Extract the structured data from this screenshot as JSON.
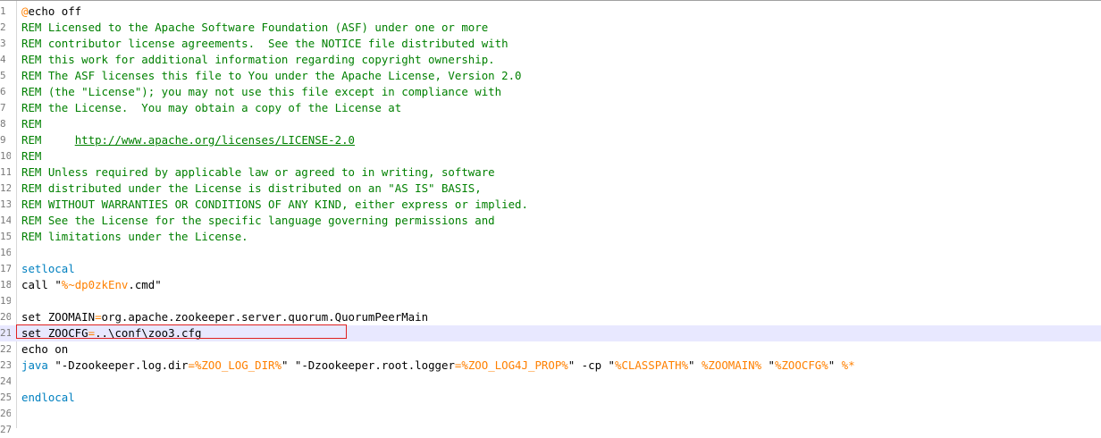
{
  "editor": {
    "highlight_color": "#e02020",
    "current_line": 21,
    "lines": [
      {
        "n": "1",
        "tokens": [
          {
            "t": "@",
            "c": "t-echo"
          },
          {
            "t": "echo off",
            "c": "t-plain"
          }
        ]
      },
      {
        "n": "2",
        "tokens": [
          {
            "t": "REM Licensed to the Apache Software Foundation (ASF) under one or more",
            "c": "t-comment"
          }
        ]
      },
      {
        "n": "3",
        "tokens": [
          {
            "t": "REM contributor license agreements.  See the NOTICE file distributed with",
            "c": "t-comment"
          }
        ]
      },
      {
        "n": "4",
        "tokens": [
          {
            "t": "REM this work for additional information regarding copyright ownership.",
            "c": "t-comment"
          }
        ]
      },
      {
        "n": "5",
        "tokens": [
          {
            "t": "REM The ASF licenses this file to You under the Apache License, Version 2.0",
            "c": "t-comment"
          }
        ]
      },
      {
        "n": "6",
        "tokens": [
          {
            "t": "REM (the \"License\"); you may not use this file except in compliance with",
            "c": "t-comment"
          }
        ]
      },
      {
        "n": "7",
        "tokens": [
          {
            "t": "REM the License.  You may obtain a copy of the License at",
            "c": "t-comment"
          }
        ]
      },
      {
        "n": "8",
        "tokens": [
          {
            "t": "REM",
            "c": "t-comment"
          }
        ]
      },
      {
        "n": "9",
        "tokens": [
          {
            "t": "REM     ",
            "c": "t-comment"
          },
          {
            "t": "http://www.apache.org/licenses/LICENSE-2.0",
            "c": "t-link"
          }
        ]
      },
      {
        "n": "10",
        "tokens": [
          {
            "t": "REM",
            "c": "t-comment"
          }
        ]
      },
      {
        "n": "11",
        "tokens": [
          {
            "t": "REM Unless required by applicable law or agreed to in writing, software",
            "c": "t-comment"
          }
        ]
      },
      {
        "n": "12",
        "tokens": [
          {
            "t": "REM distributed under the License is distributed on an \"AS IS\" BASIS,",
            "c": "t-comment"
          }
        ]
      },
      {
        "n": "13",
        "tokens": [
          {
            "t": "REM WITHOUT WARRANTIES OR CONDITIONS OF ANY KIND, either express or implied.",
            "c": "t-comment"
          }
        ]
      },
      {
        "n": "14",
        "tokens": [
          {
            "t": "REM See the License for the specific language governing permissions and",
            "c": "t-comment"
          }
        ]
      },
      {
        "n": "15",
        "tokens": [
          {
            "t": "REM limitations under the License.",
            "c": "t-comment"
          }
        ]
      },
      {
        "n": "16",
        "tokens": []
      },
      {
        "n": "17",
        "tokens": [
          {
            "t": "setlocal",
            "c": "t-blue"
          }
        ]
      },
      {
        "n": "18",
        "tokens": [
          {
            "t": "call ",
            "c": "t-plain"
          },
          {
            "t": "\"",
            "c": "t-plain"
          },
          {
            "t": "%~dp0zkEnv",
            "c": "t-var"
          },
          {
            "t": ".cmd\"",
            "c": "t-plain"
          }
        ]
      },
      {
        "n": "19",
        "tokens": []
      },
      {
        "n": "20",
        "tokens": [
          {
            "t": "set ZOOMAIN",
            "c": "t-plain"
          },
          {
            "t": "=",
            "c": "t-var"
          },
          {
            "t": "org.apache.zookeeper.server.quorum.QuorumPeerMain",
            "c": "t-plain"
          }
        ]
      },
      {
        "n": "21",
        "tokens": [
          {
            "t": "set ZOOCFG",
            "c": "t-plain"
          },
          {
            "t": "=",
            "c": "t-var"
          },
          {
            "t": "..\\conf\\zoo3.cfg",
            "c": "t-plain"
          }
        ]
      },
      {
        "n": "22",
        "tokens": [
          {
            "t": "echo on",
            "c": "t-plain"
          }
        ]
      },
      {
        "n": "23",
        "tokens": [
          {
            "t": "java ",
            "c": "t-blue"
          },
          {
            "t": "\"-Dzookeeper.log.dir",
            "c": "t-plain"
          },
          {
            "t": "=%ZOO_LOG_DIR%",
            "c": "t-var"
          },
          {
            "t": "\" \"-Dzookeeper.root.logger",
            "c": "t-plain"
          },
          {
            "t": "=%ZOO_LOG4J_PROP%",
            "c": "t-var"
          },
          {
            "t": "\" -cp \"",
            "c": "t-plain"
          },
          {
            "t": "%CLASSPATH%",
            "c": "t-var"
          },
          {
            "t": "\" ",
            "c": "t-plain"
          },
          {
            "t": "%ZOOMAIN%",
            "c": "t-var"
          },
          {
            "t": " \"",
            "c": "t-plain"
          },
          {
            "t": "%ZOOCFG%",
            "c": "t-var"
          },
          {
            "t": "\" ",
            "c": "t-plain"
          },
          {
            "t": "%*",
            "c": "t-var"
          }
        ]
      },
      {
        "n": "24",
        "tokens": []
      },
      {
        "n": "25",
        "tokens": [
          {
            "t": "endlocal",
            "c": "t-blue"
          }
        ]
      },
      {
        "n": "26",
        "tokens": []
      },
      {
        "n": "27",
        "tokens": []
      }
    ]
  }
}
